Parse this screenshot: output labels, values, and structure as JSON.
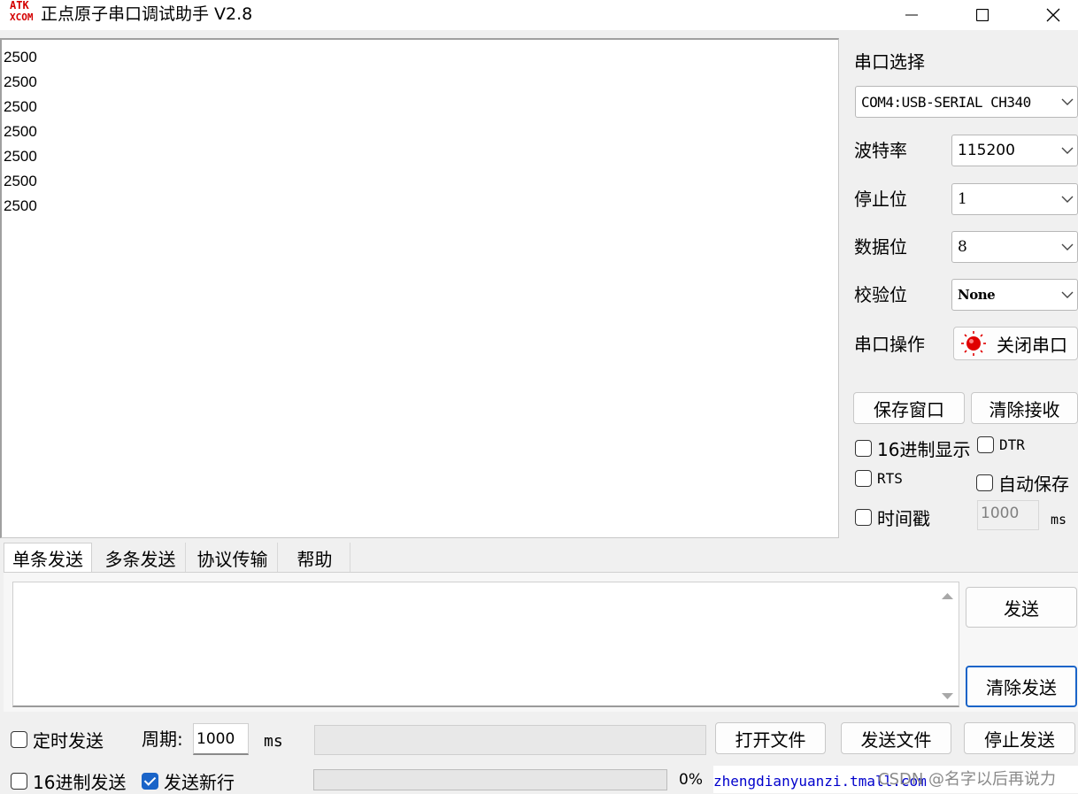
{
  "window": {
    "logo_top": "ATK",
    "logo_bottom": "XCOM",
    "title": "正点原子串口调试助手 V2.8"
  },
  "receive": {
    "lines": [
      "2500",
      "2500",
      "2500",
      "2500",
      "2500",
      "2500",
      "2500"
    ]
  },
  "settings": {
    "port_label": "串口选择",
    "port_value": "COM4:USB-SERIAL CH340",
    "baud_label": "波特率",
    "baud_value": "115200",
    "stop_label": "停止位",
    "stop_value": "1",
    "data_label": "数据位",
    "data_value": "8",
    "parity_label": "校验位",
    "parity_value": "None",
    "op_label": "串口操作",
    "op_button": "关闭串口",
    "save_window": "保存窗口",
    "clear_receive": "清除接收",
    "hex_display": "16进制显示",
    "dtr": "DTR",
    "rts": "RTS",
    "auto_save": "自动保存",
    "timestamp": "时间戳",
    "timestamp_value": "1000",
    "timestamp_unit": "ms"
  },
  "tabs": [
    "单条发送",
    "多条发送",
    "协议传输",
    "帮助"
  ],
  "send": {
    "send_button": "发送",
    "clear_send": "清除发送",
    "timed_send": "定时发送",
    "period_label": "周期:",
    "period_value": "1000",
    "period_unit": "ms",
    "open_file": "打开文件",
    "send_file": "发送文件",
    "stop_send": "停止发送",
    "hex_send": "16进制发送",
    "send_newline": "发送新行",
    "progress_text": "0%",
    "progress": 0
  },
  "footer": {
    "url": "zhengdianyuanzi.tmall.com",
    "watermark": "CSDN @名字以后再说力"
  },
  "colors": {
    "accent": "#1a64c8",
    "status_red": "#e00000",
    "url_blue": "#0000cc"
  }
}
